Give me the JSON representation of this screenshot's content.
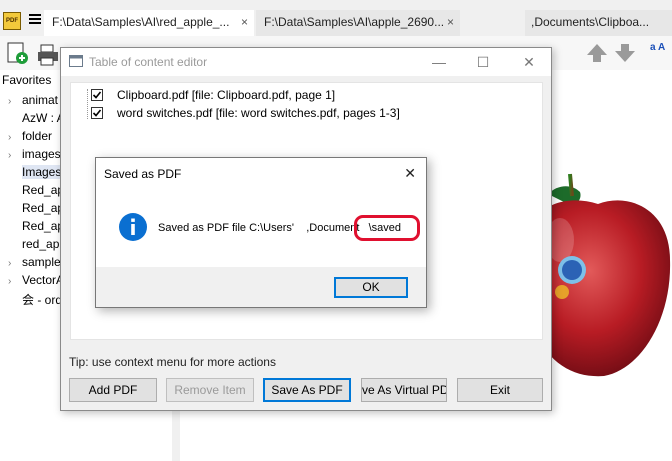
{
  "tabs": [
    {
      "label": "F:\\Data\\Samples\\AI\\red_apple_...",
      "active": true
    },
    {
      "label": "F:\\Data\\Samples\\AI\\apple_2690...",
      "active": false
    },
    {
      "label": ",Documents\\Clipboa...",
      "active": false
    }
  ],
  "tab_close_glyph": "×",
  "toolbar": {
    "text_size_label": "a A"
  },
  "favorites": {
    "title": "Favorites",
    "items": [
      {
        "label": "animat",
        "arrow": "›"
      },
      {
        "label": "AzW : A",
        "arrow": ""
      },
      {
        "label": "folder",
        "arrow": "›"
      },
      {
        "label": "images",
        "arrow": "›"
      },
      {
        "label": "Images",
        "arrow": "",
        "selected": true
      },
      {
        "label": "Red_ap",
        "arrow": ""
      },
      {
        "label": "Red_ap",
        "arrow": ""
      },
      {
        "label": "Red_ap",
        "arrow": ""
      },
      {
        "label": "red_ap",
        "arrow": ""
      },
      {
        "label": "sample",
        "arrow": "›"
      },
      {
        "label": "VectorA",
        "arrow": "›"
      },
      {
        "label": "会 - ord",
        "arrow": ""
      }
    ]
  },
  "toc_window": {
    "title": "Table of content editor",
    "minimize": "—",
    "maximize": "☐",
    "close": "✕",
    "items": [
      {
        "label": "Clipboard.pdf [file: Clipboard.pdf, page 1]",
        "checked": true
      },
      {
        "label": "word switches.pdf [file: word switches.pdf, pages 1-3]",
        "checked": true
      }
    ],
    "tip": "Tip: use context menu for more actions",
    "buttons": {
      "add_pdf": "Add PDF",
      "remove_item": "Remove Item",
      "save_as_pdf": "Save As PDF",
      "save_as_virtual": "ve As Virtual PD",
      "exit": "Exit"
    }
  },
  "saved_dialog": {
    "title": "Saved as PDF",
    "close": "✕",
    "message_prefix": "Saved as PDF file C:\\Users'",
    "message_mid": ",Document",
    "message_suffix": "\\saved",
    "ok": "OK"
  },
  "colors": {
    "accent": "#0078d7",
    "highlight": "#e0102f",
    "info": "#0a6fd1"
  }
}
